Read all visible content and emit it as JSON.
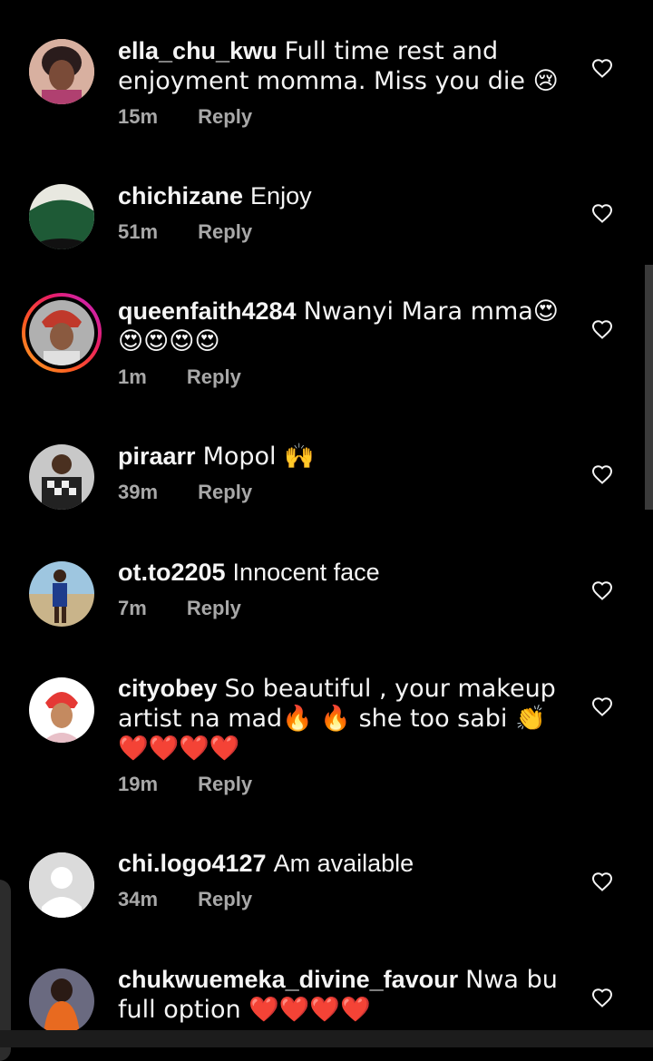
{
  "comments": [
    {
      "username": "ella_chu_kwu",
      "text": "Full time rest and enjoyment momma. Miss you die 😢",
      "time": "15m",
      "reply": "Reply"
    },
    {
      "username": "chichizane",
      "text": "Enjoy",
      "time": "51m",
      "reply": "Reply"
    },
    {
      "username": "queenfaith4284",
      "text": "Nwanyi Mara mma😍😍😍😍😍",
      "time": "1m",
      "reply": "Reply"
    },
    {
      "username": "piraarr",
      "text": "Mopol 🙌",
      "time": "39m",
      "reply": "Reply"
    },
    {
      "username": "ot.to2205",
      "text": "Innocent face",
      "time": "7m",
      "reply": "Reply"
    },
    {
      "username": "cityobey",
      "text": "So beautiful , your makeup artist na mad🔥 🔥 she too sabi 👏❤️❤️❤️❤️",
      "time": "19m",
      "reply": "Reply"
    },
    {
      "username": "chi.logo4127",
      "text": "Am available",
      "time": "34m",
      "reply": "Reply"
    },
    {
      "username": "chukwuemeka_divine_favour",
      "text": "Nwa bu full option ❤️❤️❤️❤️",
      "time": "",
      "reply": ""
    }
  ],
  "icons": {
    "like": "heart-outline-icon",
    "default_avatar": "person-silhouette-icon"
  },
  "colors": {
    "background": "#000000",
    "primary_text": "#f5f5f5",
    "secondary_text": "#a8a8a8",
    "story_ring_start": "#f9a825",
    "story_ring_end": "#c026d3"
  }
}
